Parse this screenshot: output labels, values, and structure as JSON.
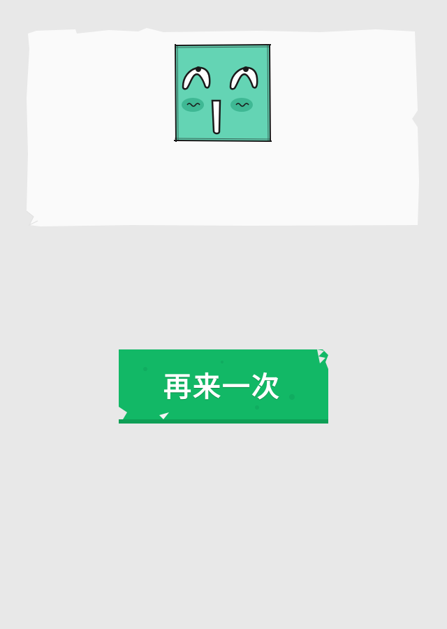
{
  "screen": {
    "background_color": "#e8e8e8"
  },
  "result_card": {
    "face_icon": "happy-square-face-icon",
    "face_color": "#64d4b4",
    "blush_color": "#3fb894"
  },
  "retry_button": {
    "label": "再来一次",
    "color": "#12b866",
    "shadow_color": "#0e9f56"
  }
}
